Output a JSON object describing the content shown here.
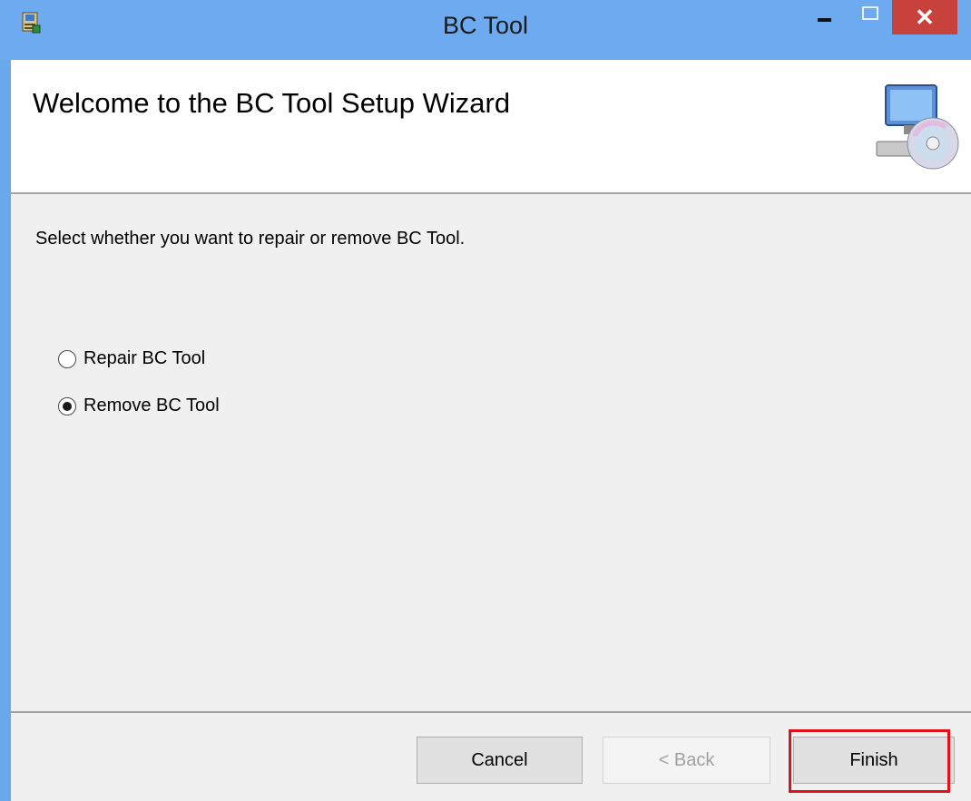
{
  "window": {
    "title": "BC Tool",
    "app_icon": "installer-icon",
    "close_glyph": "✕"
  },
  "header": {
    "title": "Welcome to the BC Tool Setup Wizard",
    "icon": "computer-cd-icon"
  },
  "body": {
    "instruction": "Select whether you want to repair or remove BC Tool.",
    "options": [
      {
        "label": "Repair BC Tool",
        "selected": false
      },
      {
        "label": "Remove BC Tool",
        "selected": true
      }
    ]
  },
  "footer": {
    "cancel_label": "Cancel",
    "back_label": "< Back",
    "finish_label": "Finish"
  },
  "colors": {
    "titlebar": "#6eaaf0",
    "close_button": "#c7423a",
    "highlight": "#e0111a"
  }
}
